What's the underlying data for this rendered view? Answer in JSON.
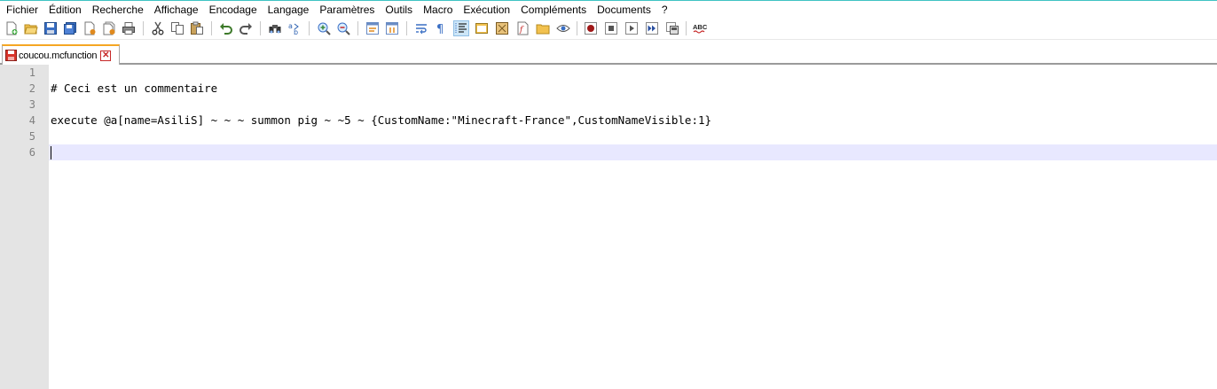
{
  "menu": [
    "Fichier",
    "Édition",
    "Recherche",
    "Affichage",
    "Encodage",
    "Langage",
    "Paramètres",
    "Outils",
    "Macro",
    "Exécution",
    "Compléments",
    "Documents",
    "?"
  ],
  "toolbar": {
    "spellcheck_label": "ABC"
  },
  "tab": {
    "filename": "coucou.mcfunction",
    "close_glyph": "✕"
  },
  "editor": {
    "line_numbers": [
      "1",
      "2",
      "3",
      "4",
      "5",
      "6"
    ],
    "lines": [
      "",
      "# Ceci est un commentaire",
      "",
      "execute @a[name=AsiliS] ~ ~ ~ summon pig ~ ~5 ~ {CustomName:\"Minecraft-France\",CustomNameVisible:1}",
      "",
      ""
    ],
    "current_line": 6
  },
  "colors": {
    "gutter": "#e4e4e4",
    "current_line": "#e8e8ff",
    "tab_accent": "#f5a623"
  }
}
